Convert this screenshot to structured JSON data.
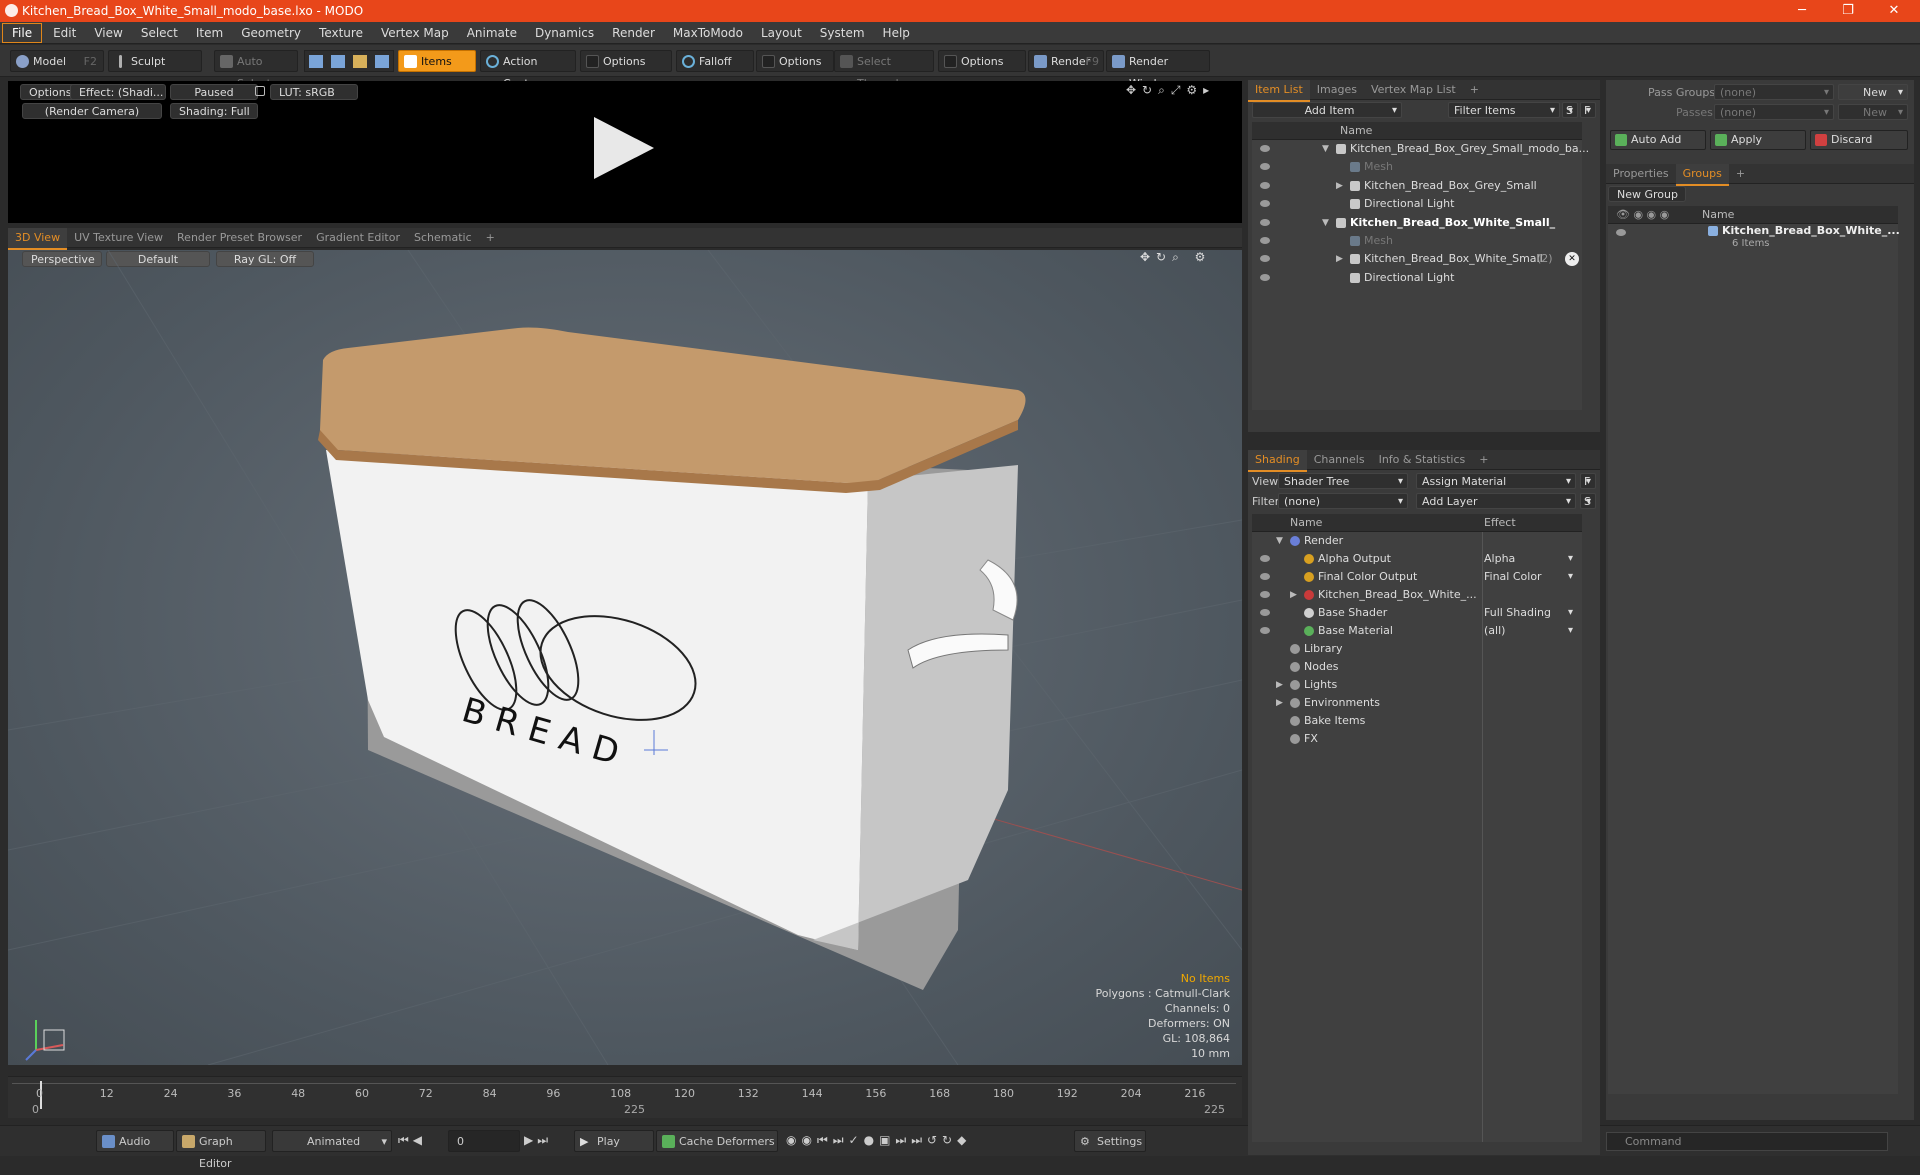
{
  "window": {
    "title": "Kitchen_Bread_Box_White_Small_modo_base.lxo - MODO",
    "min": "─",
    "max": "❐",
    "close": "✕"
  },
  "menu": [
    "File",
    "Edit",
    "View",
    "Select",
    "Item",
    "Geometry",
    "Texture",
    "Vertex Map",
    "Animate",
    "Dynamics",
    "Render",
    "MaxToModo",
    "Layout",
    "System",
    "Help"
  ],
  "toolbar": {
    "model": "Model",
    "model_key": "F2",
    "sculpt": "Sculpt",
    "auto_select": "Auto Select",
    "items": "Items",
    "action_center": "Action Center",
    "options1": "Options",
    "falloff": "Falloff",
    "options2": "Options",
    "select_through": "Select Through",
    "options3": "Options",
    "render": "Render",
    "render_key": "F9",
    "render_window": "Render Window"
  },
  "preview": {
    "options": "Options",
    "effect": "Effect: (Shadi...",
    "paused": "Paused",
    "lut": "LUT: sRGB",
    "camera": "(Render Camera)",
    "shading": "Shading: Full"
  },
  "viewport_tabs": [
    "3D View",
    "UV Texture View",
    "Render Preset Browser",
    "Gradient Editor",
    "Schematic"
  ],
  "viewport": {
    "perspective": "Perspective",
    "default": "Default",
    "raygl": "Ray GL: Off",
    "label_text": "B R E A D"
  },
  "stats": {
    "no_items": "No Items",
    "polygons": "Polygons : Catmull-Clark",
    "channels": "Channels: 0",
    "deformers": "Deformers: ON",
    "gl": "GL: 108,864",
    "size": "10 mm"
  },
  "timeline": {
    "ticks": [
      "0",
      "12",
      "24",
      "36",
      "48",
      "60",
      "72",
      "84",
      "96",
      "108",
      "120",
      "132",
      "144",
      "156",
      "168",
      "180",
      "192",
      "204",
      "216"
    ],
    "start": "0",
    "mid": "225",
    "end": "225"
  },
  "bottom": {
    "audio": "Audio",
    "graph_editor": "Graph Editor",
    "animated": "Animated",
    "frame": "0",
    "play": "Play",
    "cache": "Cache Deformers",
    "settings": "Settings",
    "command": "Command"
  },
  "item_list": {
    "tabs": [
      "Item List",
      "Images",
      "Vertex Map List"
    ],
    "add_item": "Add Item",
    "filter_items": "Filter Items",
    "s": "S",
    "f": "F",
    "col_name": "Name",
    "rows": [
      {
        "label": "Kitchen_Bread_Box_Grey_Small_modo_ba...",
        "indent": 0,
        "arrow": "▼",
        "dim": false,
        "bold": false
      },
      {
        "label": "Mesh",
        "indent": 1,
        "arrow": "",
        "dim": true,
        "bold": false
      },
      {
        "label": "Kitchen_Bread_Box_Grey_Small",
        "indent": 1,
        "arrow": "▶",
        "dim": false,
        "bold": false
      },
      {
        "label": "Directional Light",
        "indent": 1,
        "arrow": "",
        "dim": false,
        "bold": false
      },
      {
        "label": "Kitchen_Bread_Box_White_Small_",
        "indent": 0,
        "arrow": "▼",
        "dim": false,
        "bold": true
      },
      {
        "label": "Mesh",
        "indent": 1,
        "arrow": "",
        "dim": true,
        "bold": false
      },
      {
        "label": "Kitchen_Bread_Box_White_Small",
        "indent": 1,
        "arrow": "▶",
        "dim": false,
        "bold": false,
        "suffix": "(2)"
      },
      {
        "label": "Directional Light",
        "indent": 1,
        "arrow": "",
        "dim": false,
        "bold": false
      }
    ]
  },
  "shading": {
    "tabs": [
      "Shading",
      "Channels",
      "Info & Statistics"
    ],
    "view_label": "View",
    "view_value": "Shader Tree",
    "assign": "Assign Material",
    "f": "F",
    "filter_label": "Filter",
    "filter_value": "(none)",
    "add_layer": "Add Layer",
    "s": "S",
    "col_name": "Name",
    "col_effect": "Effect",
    "rows": [
      {
        "label": "Render",
        "effect": "",
        "indent": 0,
        "arrow": "▼",
        "color": "#6a7fd8",
        "eye": false
      },
      {
        "label": "Alpha Output",
        "effect": "Alpha",
        "indent": 1,
        "arrow": "",
        "color": "#d8a020",
        "eye": true
      },
      {
        "label": "Final Color Output",
        "effect": "Final Color",
        "indent": 1,
        "arrow": "",
        "color": "#d8a020",
        "eye": true
      },
      {
        "label": "Kitchen_Bread_Box_White_...",
        "effect": "",
        "indent": 1,
        "arrow": "▶",
        "color": "#c83a3a",
        "eye": true
      },
      {
        "label": "Base Shader",
        "effect": "Full Shading",
        "indent": 1,
        "arrow": "",
        "color": "#d0d0d0",
        "eye": true
      },
      {
        "label": "Base Material",
        "effect": "(all)",
        "indent": 1,
        "arrow": "",
        "color": "#5ab05a",
        "eye": true
      },
      {
        "label": "Library",
        "effect": "",
        "indent": 0,
        "arrow": "",
        "color": "",
        "eye": false
      },
      {
        "label": "Nodes",
        "effect": "",
        "indent": 0,
        "arrow": "",
        "color": "",
        "eye": false
      },
      {
        "label": "Lights",
        "effect": "",
        "indent": 0,
        "arrow": "▶",
        "color": "",
        "eye": false
      },
      {
        "label": "Environments",
        "effect": "",
        "indent": 0,
        "arrow": "▶",
        "color": "",
        "eye": false
      },
      {
        "label": "Bake Items",
        "effect": "",
        "indent": 0,
        "arrow": "",
        "color": "",
        "eye": false
      },
      {
        "label": "FX",
        "effect": "",
        "indent": 0,
        "arrow": "",
        "color": "",
        "eye": false
      }
    ]
  },
  "groups": {
    "pass_groups": "Pass Groups",
    "pass_groups_value": "(none)",
    "new": "New",
    "passes": "Passes",
    "passes_value": "(none)",
    "new2": "New",
    "auto_add": "Auto Add",
    "apply": "Apply",
    "discard": "Discard",
    "tabs": [
      "Properties",
      "Groups"
    ],
    "new_group": "New Group",
    "col_name": "Name",
    "group_name": "Kitchen_Bread_Box_White_...",
    "group_count": "6 Items"
  }
}
